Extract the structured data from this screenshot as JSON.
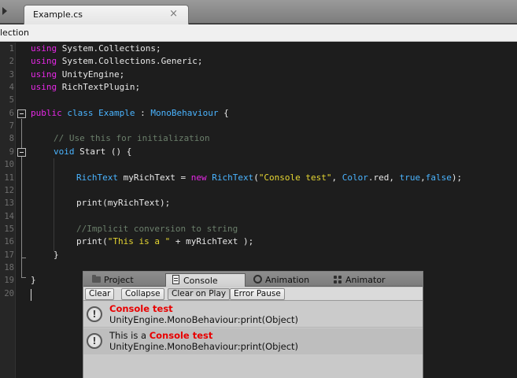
{
  "tab": {
    "label": "Example.cs",
    "close_glyph": "×"
  },
  "subbar": {
    "label": "lection"
  },
  "line_numbers": [
    "1",
    "2",
    "3",
    "4",
    "5",
    "6",
    "7",
    "8",
    "9",
    "10",
    "11",
    "12",
    "13",
    "14",
    "15",
    "16",
    "17",
    "18",
    "19",
    "20"
  ],
  "code": {
    "l1": {
      "kw": "using",
      "rest": " System.Collections;"
    },
    "l2": {
      "kw": "using",
      "rest": " System.Collections.Generic;"
    },
    "l3": {
      "kw": "using",
      "rest": " UnityEngine;"
    },
    "l4": {
      "kw": "using",
      "rest": " RichTextPlugin;"
    },
    "l6": {
      "kw1": "public",
      "kw2": "class",
      "cls": "Example",
      "colon": " : ",
      "base": "MonoBehaviour",
      "brace": " {"
    },
    "l8": {
      "comment": "// Use this for initialization"
    },
    "l9": {
      "kw": "void",
      "rest": " Start () {"
    },
    "l11": {
      "type1": "RichText",
      "var": " myRichText = ",
      "kw": "new",
      "type2": "RichText",
      "open": "(",
      "str": "\"Console test\"",
      "comma": ", ",
      "color": "Color",
      "red": ".red, ",
      "t": "true",
      "c2": ",",
      "f": "false",
      "close": ");"
    },
    "l13": {
      "text": "print(myRichText);"
    },
    "l15": {
      "comment": "//Implicit conversion to string"
    },
    "l16": {
      "a": "print(",
      "str": "\"This is a \"",
      "b": " + myRichText );"
    },
    "l17": {
      "text": "}"
    },
    "l19": {
      "text": "}"
    }
  },
  "console": {
    "tabs": [
      {
        "label": "Project",
        "icon": "folder-icon"
      },
      {
        "label": "Console",
        "icon": "console-icon"
      },
      {
        "label": "Animation",
        "icon": "animation-icon"
      },
      {
        "label": "Animator",
        "icon": "animator-icon"
      }
    ],
    "toolbar": [
      "Clear",
      "Collapse",
      "Clear on Play",
      "Error Pause"
    ],
    "entries": [
      {
        "prefix": "",
        "highlight": "Console test",
        "trace": "UnityEngine.MonoBehaviour:print(Object)"
      },
      {
        "prefix": "This is a ",
        "highlight": "Console test",
        "trace": "UnityEngine.MonoBehaviour:print(Object)"
      }
    ],
    "warn_glyph": "!"
  },
  "colors": {
    "keyword": "#e628e6",
    "type": "#4ab4ff",
    "comment": "#6b7f6b",
    "string": "#e6d632",
    "log_highlight": "#e80000"
  }
}
